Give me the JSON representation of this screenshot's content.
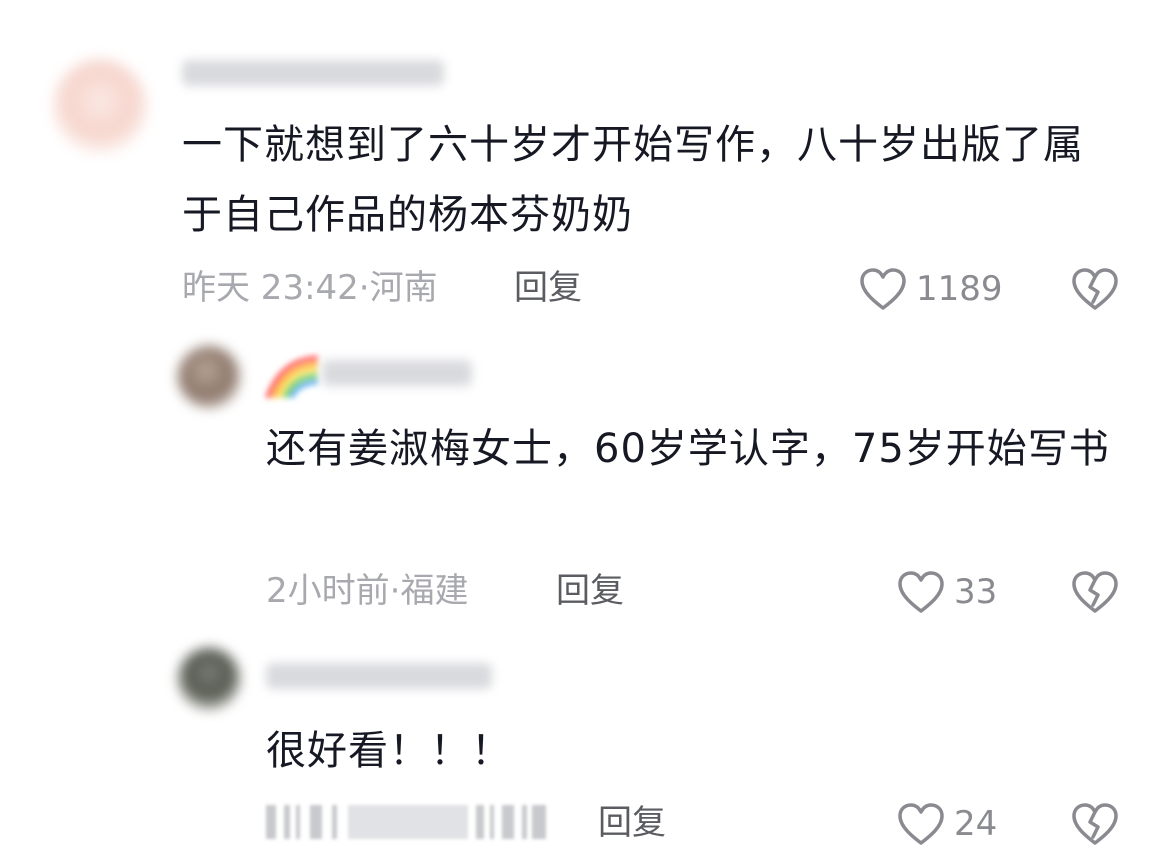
{
  "comments": [
    {
      "text": "一下就想到了六十岁才开始写作，八十岁出版了属于自己作品的杨本芬奶奶",
      "meta": "昨天 23:42·河南",
      "reply_label": "回复",
      "likes": "1189",
      "like_icon": "heart-outline-icon",
      "dislike_icon": "broken-heart-icon"
    }
  ],
  "replies": [
    {
      "text": "还有姜淑梅女士，60岁学认字，75岁开始写书",
      "meta": "2小时前·福建",
      "reply_label": "回复",
      "likes": "33",
      "like_icon": "heart-outline-icon",
      "dislike_icon": "broken-heart-icon"
    },
    {
      "text": "很好看！！！",
      "reply_label": "回复",
      "likes": "24",
      "like_icon": "heart-outline-icon",
      "dislike_icon": "broken-heart-icon"
    }
  ],
  "colors": {
    "text_primary": "#161823",
    "text_secondary": "#a8a9ae",
    "reply_label": "#5b5c61",
    "icon_stroke": "#8a8b90"
  }
}
